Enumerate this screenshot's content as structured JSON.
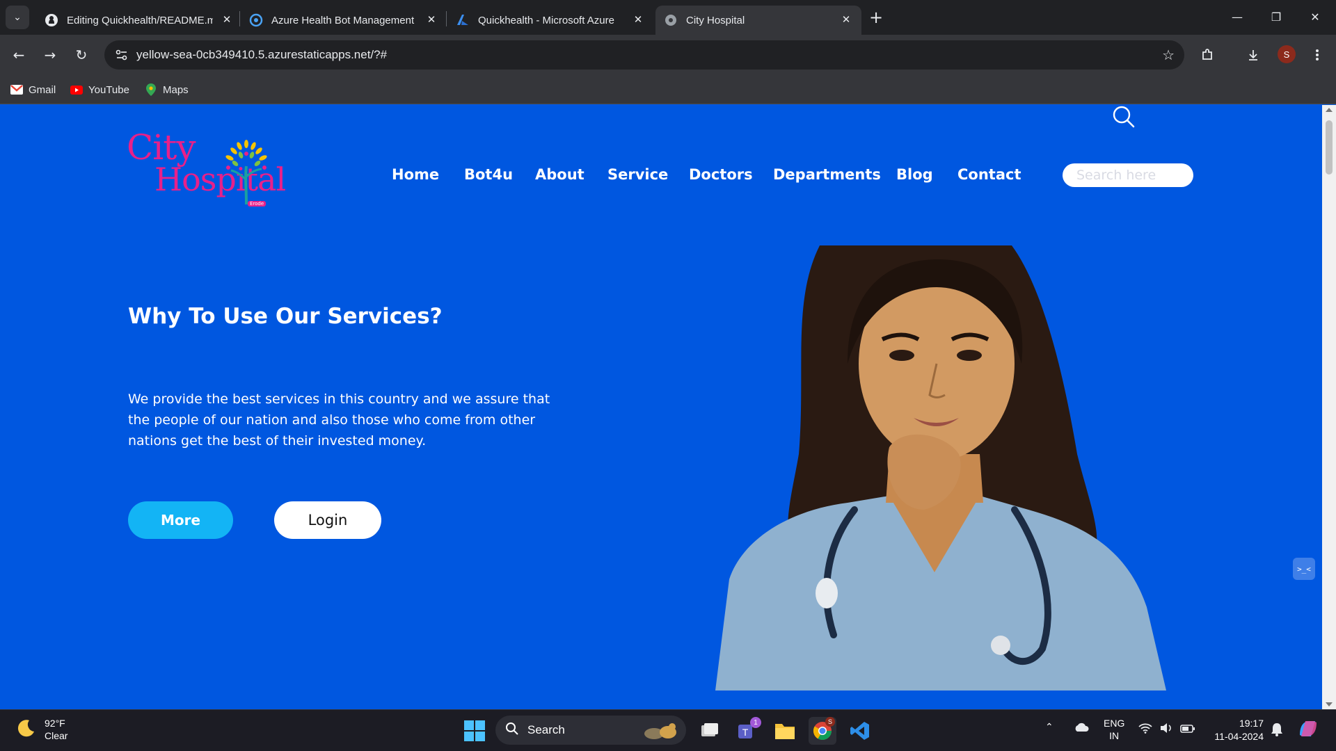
{
  "browser": {
    "tabs": [
      {
        "title": "Editing Quickhealth/README.m",
        "favicon": "github-icon"
      },
      {
        "title": "Azure Health Bot Management",
        "favicon": "health-bot-icon"
      },
      {
        "title": "Quickhealth - Microsoft Azure",
        "favicon": "azure-icon"
      },
      {
        "title": "City Hospital",
        "favicon": "globe-icon",
        "active": true
      }
    ],
    "url": "yellow-sea-0cb349410.5.azurestaticapps.net/?#",
    "profile_initial": "S",
    "bookmarks": [
      {
        "label": "Gmail",
        "icon": "gmail-icon"
      },
      {
        "label": "YouTube",
        "icon": "youtube-icon"
      },
      {
        "label": "Maps",
        "icon": "maps-icon"
      }
    ]
  },
  "site": {
    "logo": {
      "line1": "City",
      "line2": "Hospital",
      "tag": "Erode"
    },
    "nav": [
      "Home",
      "Bot4u",
      "About",
      "Service",
      "Doctors",
      "Departments",
      "Blog",
      "Contact"
    ],
    "search_placeholder": "Search here",
    "hero": {
      "title": "Why To Use Our Services?",
      "text": "We provide the best services in this country and we assure that the people of our nation and also those who come from other nations get the best of their invested money.",
      "more_label": "More",
      "login_label": "Login"
    },
    "colors": {
      "background": "#0057e0",
      "logo": "#e8208a",
      "more_button": "#13b4f5"
    }
  },
  "taskbar": {
    "weather_temp": "92°F",
    "weather_cond": "Clear",
    "search_label": "Search",
    "teams_badge": "1",
    "chrome_badge": "S",
    "lang_line1": "ENG",
    "lang_line2": "IN",
    "time": "19:17",
    "date": "11-04-2024"
  }
}
